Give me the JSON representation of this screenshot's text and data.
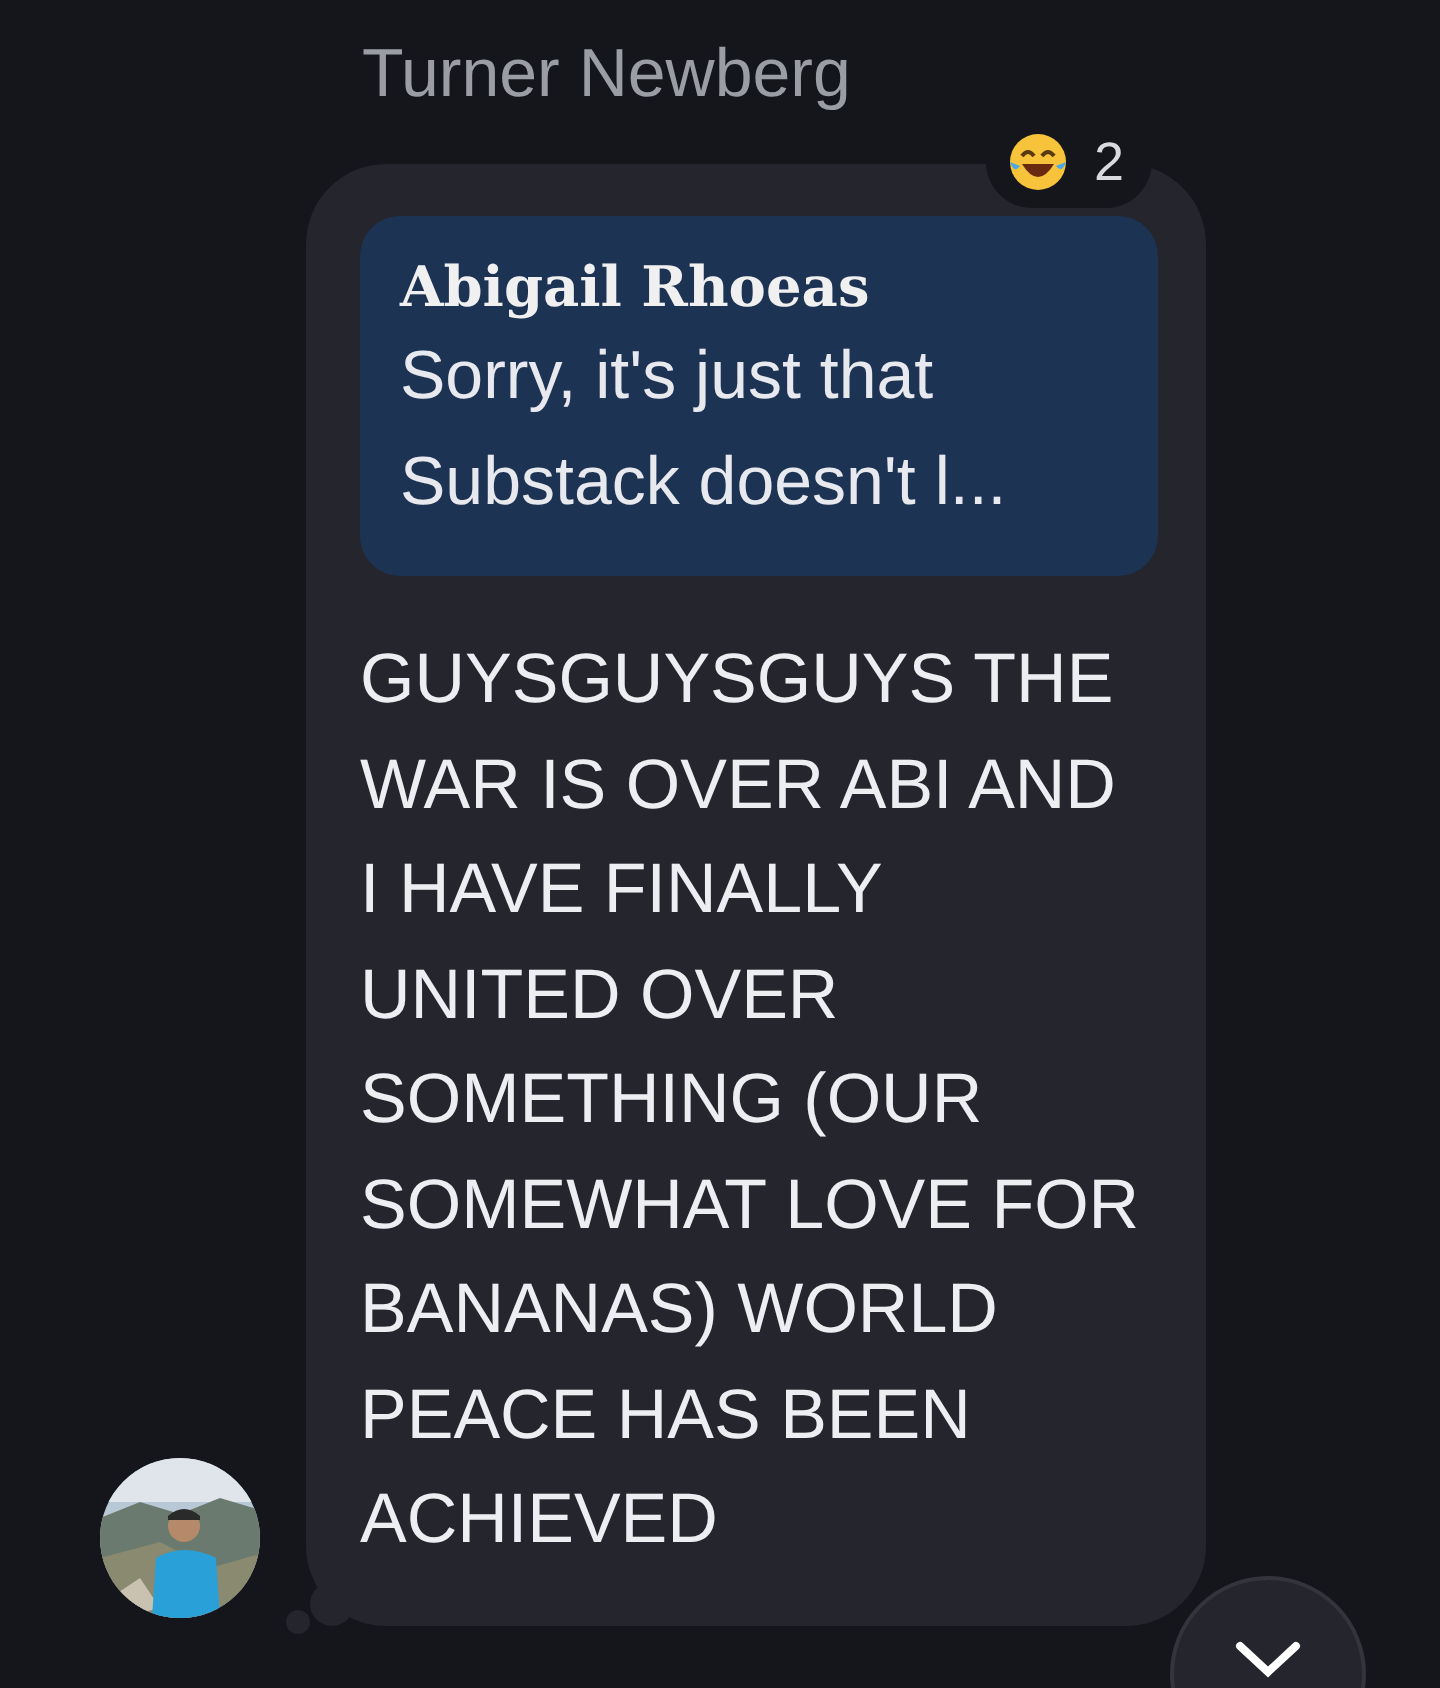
{
  "sender": "Turner Newberg",
  "reaction": {
    "count": "2"
  },
  "quote": {
    "author": "Abigail Rhoeas",
    "text": "Sorry, it's just that Substack doesn't l..."
  },
  "message": "GUYSGUYSGUYS THE WAR IS OVER ABI AND I HAVE FINALLY UNITED OVER SOMETHING (OUR SOMEWHAT LOVE FOR BANANAS) WORLD PEACE HAS BEEN ACHIEVED"
}
